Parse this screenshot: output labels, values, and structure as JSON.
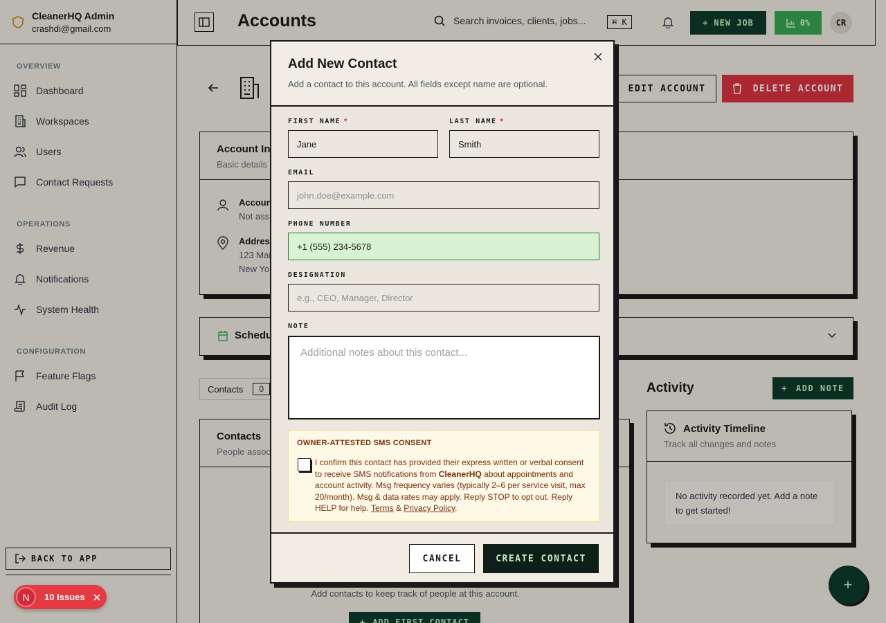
{
  "sidebar": {
    "app_title": "CleanerHQ Admin",
    "email": "crashdi@gmail.com",
    "sections": [
      {
        "title": "OVERVIEW"
      },
      {
        "title": "OPERATIONS"
      },
      {
        "title": "CONFIGURATION"
      }
    ],
    "items": [
      {
        "label": "Dashboard"
      },
      {
        "label": "Workspaces"
      },
      {
        "label": "Users"
      },
      {
        "label": "Contact Requests"
      },
      {
        "label": "Revenue"
      },
      {
        "label": "Notifications"
      },
      {
        "label": "System Health"
      },
      {
        "label": "Feature Flags"
      },
      {
        "label": "Audit Log"
      }
    ],
    "back_label": "BACK TO APP",
    "issues": {
      "badge": "N",
      "label": "10 Issues"
    }
  },
  "header": {
    "title": "Accounts",
    "search_placeholder": "Search invoices, clients, jobs...",
    "shortcut": "⌘ K",
    "new_job_label": "NEW JOB",
    "pct_label": "0%",
    "avatar_initials": "CR"
  },
  "page": {
    "edit_label": "EDIT ACCOUNT",
    "delete_label": "DELETE ACCOUNT",
    "account_info_title": "Account In",
    "account_info_sub": "Basic details",
    "account_label": "Accoun",
    "account_value": "Not ass",
    "address_label": "Address",
    "address_line1": "123 Mai",
    "address_line2": "New Yo",
    "schedule_label": "Schedu",
    "tab_contacts": "Contacts",
    "tab_count": "0",
    "contacts_title": "Contacts",
    "contacts_sub": "People assoc",
    "contacts_empty": "Add contacts to keep track of people at this account.",
    "add_first_label": "ADD FIRST CONTACT",
    "activity_title": "Activity",
    "add_note_label": "ADD NOTE",
    "timeline_title": "Activity Timeline",
    "timeline_sub": "Track all changes and notes",
    "timeline_empty": "No activity recorded yet. Add a note to get started!"
  },
  "modal": {
    "title": "Add New Contact",
    "subtitle": "Add a contact to this account. All fields except name are optional.",
    "first_name_label": "FIRST NAME",
    "first_name_value": "Jane",
    "last_name_label": "LAST NAME",
    "last_name_value": "Smith",
    "required_mark": "*",
    "email_label": "EMAIL",
    "email_placeholder": "john.doe@example.com",
    "phone_label": "PHONE NUMBER",
    "phone_value": "+1 (555) 234-5678",
    "designation_label": "DESIGNATION",
    "designation_placeholder": "e.g., CEO, Manager, Director",
    "note_label": "NOTE",
    "note_placeholder": "Additional notes about this contact...",
    "consent_title": "OWNER-ATTESTED SMS CONSENT",
    "consent_text_1": "I confirm this contact has provided their express written or verbal consent to receive SMS notifications from ",
    "consent_brand": "CleanerHQ",
    "consent_text_2": " about appointments and account activity. Msg frequency varies (typically 2–6 per service visit, max 20/month). Msg & data rates may apply. Reply STOP to opt out. Reply HELP for help. ",
    "consent_terms": "Terms",
    "consent_amp": " & ",
    "consent_privacy": "Privacy Policy",
    "consent_end": ".",
    "cancel_label": "CANCEL",
    "create_label": "CREATE CONTACT"
  },
  "colors": {
    "accent_dark": "#0f3b2c",
    "accent_green": "#36a852",
    "danger": "#dc3340",
    "focus_field": "#d8f3d3",
    "consent_bg": "#fef9e6"
  }
}
